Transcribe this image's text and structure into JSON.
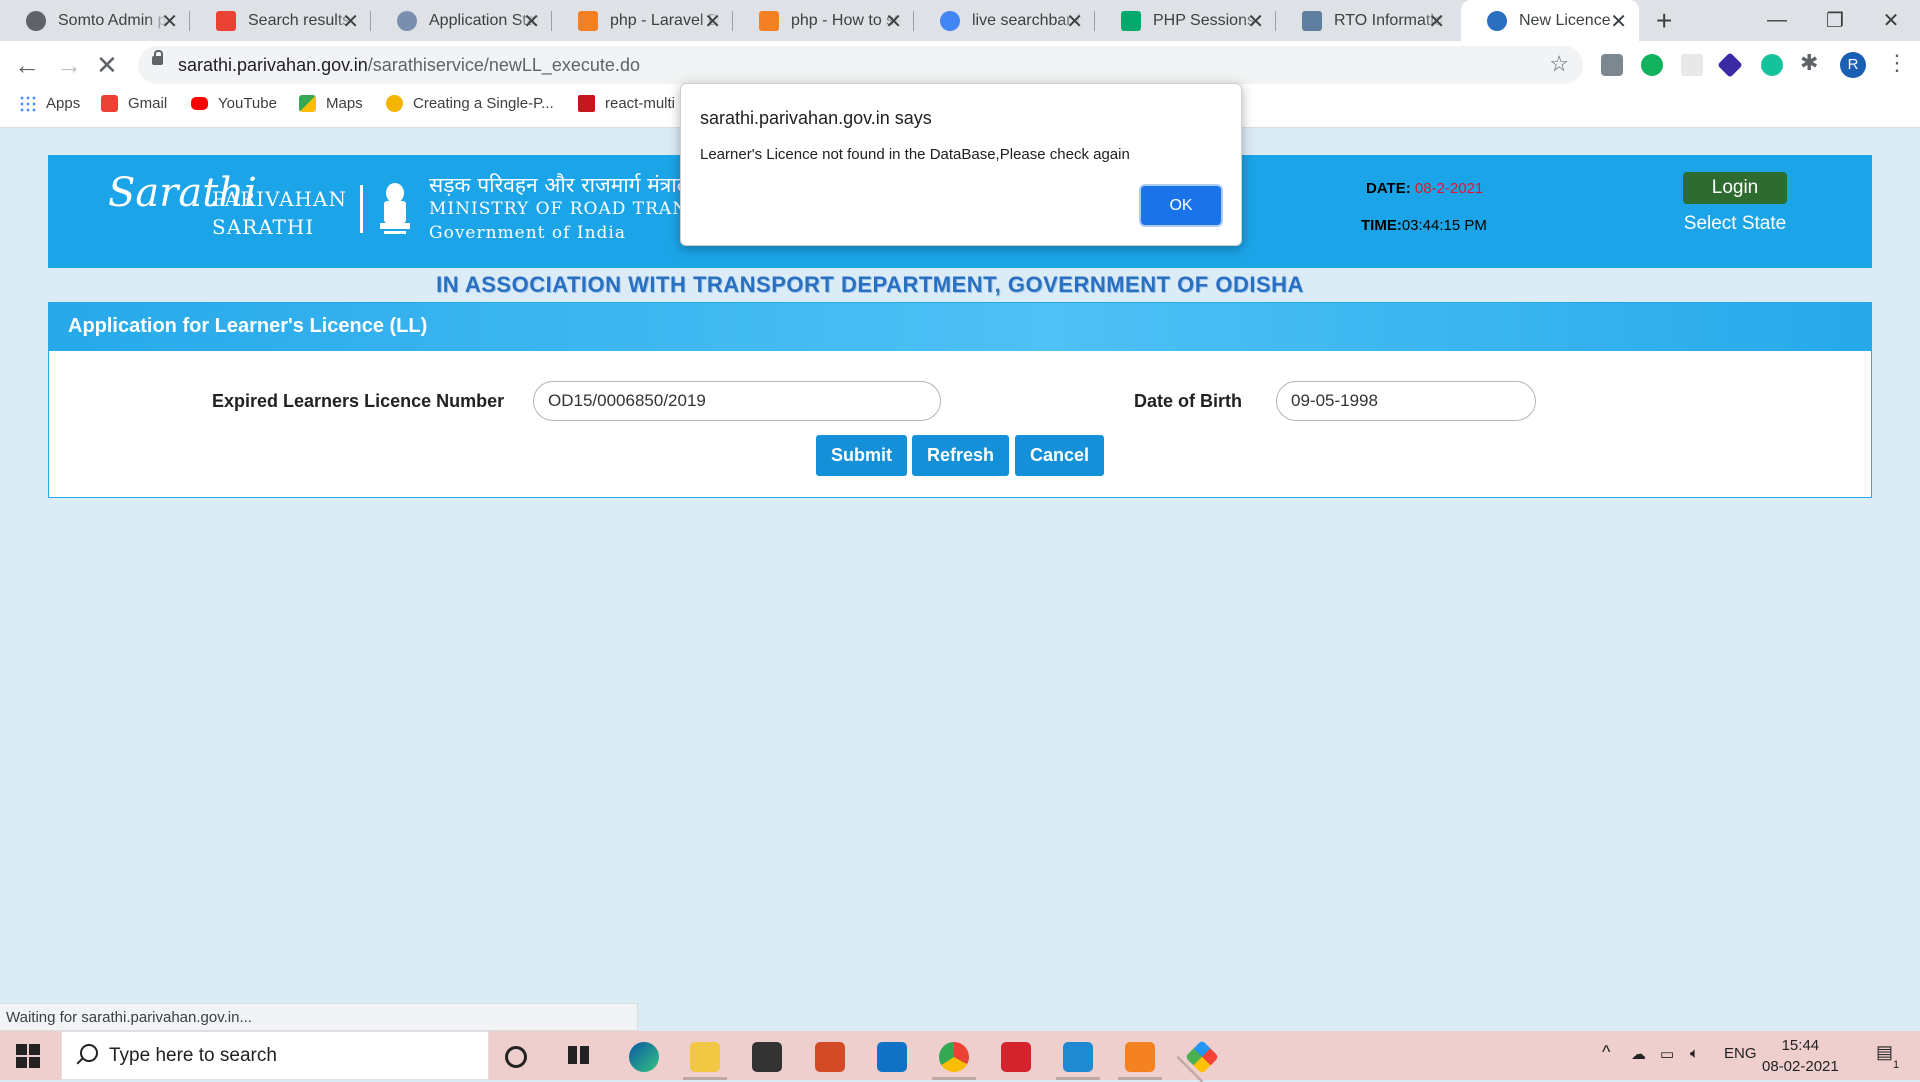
{
  "browser": {
    "tabs": [
      {
        "title": "Somto Admin panel",
        "favicon_color": "#5f6368"
      },
      {
        "title": "Search results - Gmail",
        "favicon_color": "#ea4335"
      },
      {
        "title": "Application Status",
        "favicon_color": "#7a8fb0"
      },
      {
        "title": "php - Laravel Datatable",
        "favicon_color": "#f48024"
      },
      {
        "title": "php - How to store",
        "favicon_color": "#f48024"
      },
      {
        "title": "live searchbar from",
        "favicon_color": "#4285f4"
      },
      {
        "title": "PHP Sessions",
        "favicon_color": "#04aa6d"
      },
      {
        "title": "RTO Information",
        "favicon_color": "#5f7fa0"
      },
      {
        "title": "New Licence",
        "favicon_color": "#2a6fc0",
        "active": true
      }
    ],
    "url_host": "sarathi.parivahan.gov.in",
    "url_path": "/sarathiservice/newLL_execute.do",
    "profile_initial": "R",
    "bookmarks": [
      {
        "label": "Apps",
        "icon": "apps-grid-icon",
        "color": "#4285f4"
      },
      {
        "label": "Gmail",
        "icon": "gmail-icon",
        "color": "#ea4335"
      },
      {
        "label": "YouTube",
        "icon": "youtube-icon",
        "color": "#ff0000"
      },
      {
        "label": "Maps",
        "icon": "maps-icon",
        "color": "#34a853"
      },
      {
        "label": "Creating a Single-P...",
        "icon": "bookmark-icon",
        "color": "#f4b400"
      },
      {
        "label": "react-multi",
        "icon": "bookmark-icon",
        "color": "#c4161c"
      }
    ],
    "status_text": "Waiting for sarathi.parivahan.gov.in..."
  },
  "header": {
    "logo_mark": "Sarathi",
    "logo_line1": "PARIVAHAN",
    "logo_line2": "SARATHI",
    "ministry_hi": "सड़क परिवहन और राजमार्ग मंत्रालय",
    "ministry_en": "MINISTRY OF ROAD TRANSPORT",
    "ministry_gov": "Government of India",
    "date_label": "DATE:",
    "date_value": "08-2-2021",
    "time_label": "TIME:",
    "time_value": "03:44:15 PM",
    "login_label": "Login",
    "select_state_label": "Select State",
    "association": "IN ASSOCIATION WITH TRANSPORT DEPARTMENT, GOVERNMENT OF ODISHA"
  },
  "form": {
    "title": "Application for Learner's Licence (LL)",
    "ll_label": "Expired Learners Licence Number",
    "ll_value": "OD15/0006850/2019",
    "dob_label": "Date of Birth",
    "dob_value": "09-05-1998",
    "submit_label": "Submit",
    "refresh_label": "Refresh",
    "cancel_label": "Cancel"
  },
  "dialog": {
    "title": "sarathi.parivahan.gov.in says",
    "message": "Learner's Licence not found in the DataBase,Please check again",
    "ok_label": "OK"
  },
  "taskbar": {
    "search_placeholder": "Type here to search",
    "language": "ENG",
    "time": "15:44",
    "date": "08-02-2021",
    "notification_count": "1"
  }
}
